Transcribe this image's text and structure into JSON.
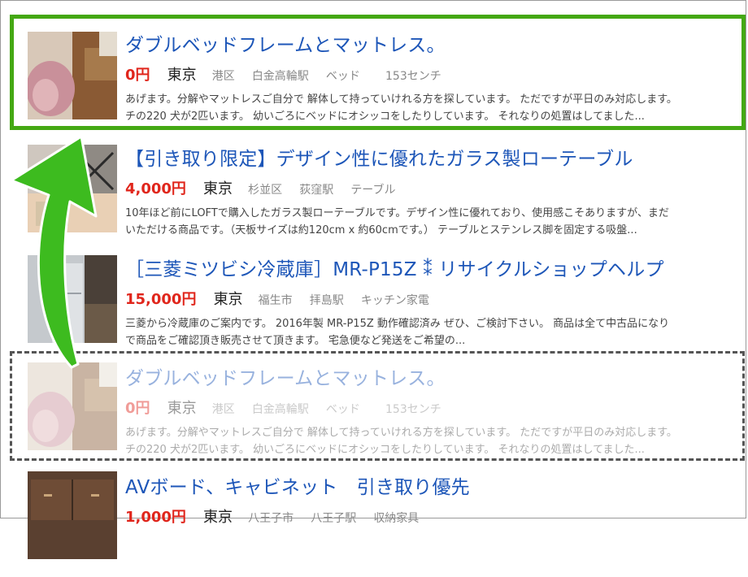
{
  "listings": [
    {
      "title": "ダブルベッドフレームとマットレス。",
      "price": "0円",
      "city": "東京",
      "tags": [
        "港区",
        "白金高輪駅",
        "ベッド",
        "153センチ"
      ],
      "desc_line1": "あげます。分解やマットレスご自分で 解体して持っていけれる方を探しています。 ただですが平日のみ対応します。",
      "desc_line2": "チの220 犬が2匹います。 幼いごろにベッドにオシッコをしたりしています。 それなりの処置はしてました..."
    },
    {
      "title": "【引き取り限定】デザイン性に優れたガラス製ローテーブル",
      "price": "4,000円",
      "city": "東京",
      "tags": [
        "杉並区",
        "荻窪駅",
        "テーブル"
      ],
      "desc_line1": "10年ほど前にLOFTで購入したガラス製ローテーブルです。デザイン性に優れており、使用感こそありますが、まだ",
      "desc_line2": "いただける商品です。（天板サイズは約120cm x 約60cmです。） テーブルとステンレス脚を固定する吸盤..."
    },
    {
      "title": "［三菱ミツビシ冷蔵庫］MR-P15Z ⁑ リサイクルショップヘルプ",
      "price": "15,000円",
      "city": "東京",
      "tags": [
        "福生市",
        "拝島駅",
        "キッチン家電"
      ],
      "desc_line1": "三菱から冷蔵庫のご案内です。 2016年製 MR-P15Z 動作確認済み ぜひ、ご検討下さい。 商品は全て中古品になり",
      "desc_line2": "で商品をご確認頂き販売させて頂きます。 宅急便など発送をご希望の..."
    },
    {
      "title": "ダブルベッドフレームとマットレス。",
      "price": "0円",
      "city": "東京",
      "tags": [
        "港区",
        "白金高輪駅",
        "ベッド",
        "153センチ"
      ],
      "desc_line1": "あげます。分解やマットレスご自分で 解体して持っていけれる方を探しています。 ただですが平日のみ対応します。",
      "desc_line2": "チの220 犬が2匹います。 幼いごろにベッドにオシッコをしたりしています。 それなりの処置はしてました..."
    },
    {
      "title": "AVボード、キャビネット　引き取り優先",
      "price": "1,000円",
      "city": "東京",
      "tags": [
        "八王子市",
        "八王子駅",
        "収納家具"
      ],
      "desc_line1": "",
      "desc_line2": ""
    }
  ],
  "colors": {
    "title": "#1d56b8",
    "price": "#e0261c",
    "highlight": "#44a813",
    "arrow": "#3dbb1f"
  }
}
